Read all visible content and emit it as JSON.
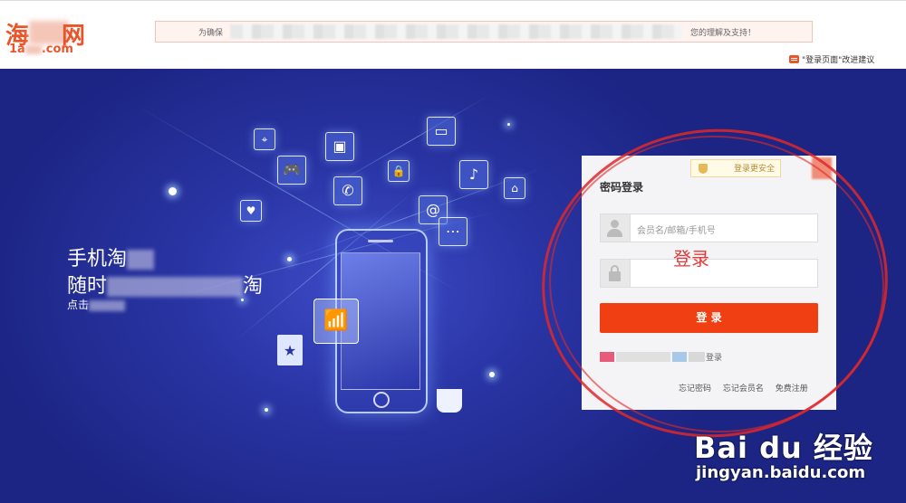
{
  "header": {
    "logo_char_left": "海",
    "logo_char_right": "网",
    "logo_domain": ".com",
    "logo_prefix": "1a",
    "notice_start": "为确保",
    "notice_end": "您的理解及支持！",
    "feedback_text": "\"登录页面\"改进建议"
  },
  "banner": {
    "slogan_line1": "手机淘",
    "slogan_line2_start": "随时",
    "slogan_line2_end": "淘",
    "slogan_line3": "点击"
  },
  "login": {
    "safety_badge": "登录更安全",
    "title": "密码登录",
    "username_placeholder": "会员名/邮箱/手机号",
    "password_placeholder": "",
    "login_button": "登 录",
    "other_login_suffix": "登录",
    "forgot_password": "忘记密码",
    "forgot_username": "忘记会员名",
    "register": "免费注册"
  },
  "annotation": {
    "text": "登录",
    "color": "#e23b3b"
  },
  "watermark": {
    "brand": "Bai du 经验",
    "url": "jingyan.baidu.com"
  },
  "colors": {
    "accent": "#f03f12",
    "banner_bg": "#2a35a5",
    "logo": "#e8552a"
  },
  "icons": [
    "map-pin-icon",
    "gamepad-icon",
    "briefcase-icon",
    "phone-icon",
    "lock-icon",
    "tv-icon",
    "microphone-icon",
    "hanger-icon",
    "heart-icon",
    "at-icon",
    "share-icon",
    "wifi-icon",
    "shopping-bag-icon",
    "coffee-cup-icon"
  ]
}
